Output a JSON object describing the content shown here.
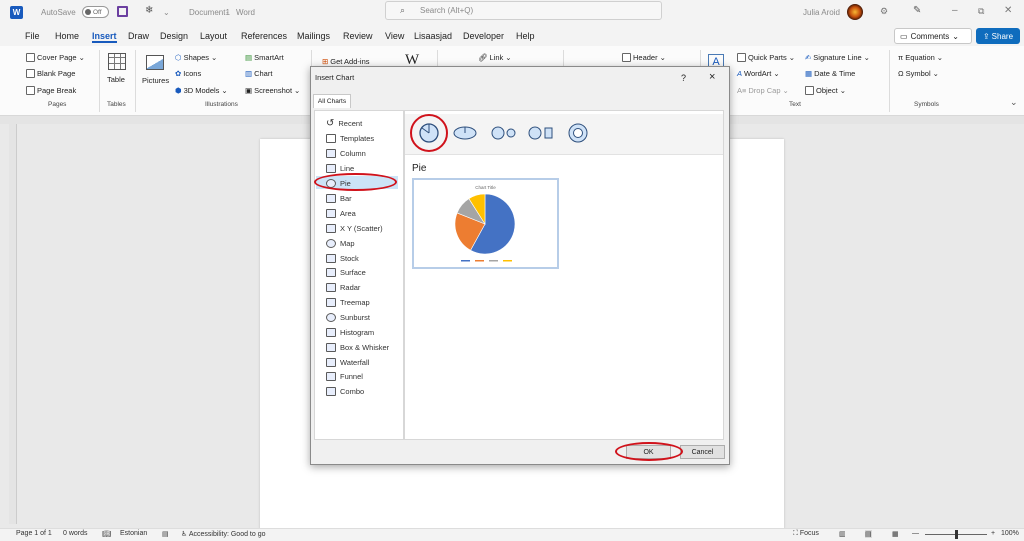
{
  "title_bar": {
    "autosave_label": "AutoSave",
    "autosave_state": "Off",
    "document_name": "Document1",
    "app_name": "Word",
    "search_placeholder": "Search (Alt+Q)",
    "user_name": "Julia Aroid"
  },
  "menu_tabs": [
    "File",
    "Home",
    "Insert",
    "Draw",
    "Design",
    "Layout",
    "References",
    "Mailings",
    "Review",
    "View",
    "Lisaasjad",
    "Developer",
    "Help"
  ],
  "active_tab": "Insert",
  "comments_label": "Comments",
  "share_label": "Share",
  "ribbon": {
    "pages": {
      "items": [
        "Cover Page",
        "Blank Page",
        "Page Break"
      ],
      "group": "Pages"
    },
    "tables": {
      "item": "Table",
      "group": "Tables"
    },
    "illustrations": {
      "pictures": "Pictures",
      "shapes": "Shapes",
      "icons": "Icons",
      "models3d": "3D Models",
      "smartart": "SmartArt",
      "chart": "Chart",
      "screenshot": "Screenshot",
      "group": "Illustrations"
    },
    "addins": {
      "get_addins": "Get Add-ins"
    },
    "links": {
      "link": "Link"
    },
    "header": {
      "header": "Header"
    },
    "text": {
      "quick_parts": "Quick Parts",
      "wordart": "WordArt",
      "drop_cap": "Drop Cap",
      "signature_line": "Signature Line",
      "date_time": "Date & Time",
      "object": "Object",
      "group": "Text"
    },
    "symbols": {
      "equation": "Equation",
      "symbol": "Symbol",
      "group": "Symbols"
    }
  },
  "dialog": {
    "title": "Insert Chart",
    "help": "?",
    "close": "×",
    "tab": "All Charts",
    "chart_types": [
      "Recent",
      "Templates",
      "Column",
      "Line",
      "Pie",
      "Bar",
      "Area",
      "X Y (Scatter)",
      "Map",
      "Stock",
      "Surface",
      "Radar",
      "Treemap",
      "Sunburst",
      "Histogram",
      "Box & Whisker",
      "Waterfall",
      "Funnel",
      "Combo"
    ],
    "selected_type": "Pie",
    "preview_heading": "Pie",
    "preview_chart_title": "Chart Title",
    "ok": "OK",
    "cancel": "Cancel"
  },
  "preview_chart": {
    "type": "pie",
    "values": [
      58,
      23,
      10,
      9
    ],
    "colors": [
      "#4472c4",
      "#ed7d31",
      "#a5a5a5",
      "#ffc000"
    ]
  },
  "status_bar": {
    "page": "Page 1 of 1",
    "words": "0 words",
    "language": "Estonian",
    "accessibility": "Accessibility: Good to go",
    "focus": "Focus",
    "zoom": "100%"
  },
  "colors": {
    "word_blue": "#185abd",
    "annotation_red": "#d0121b",
    "selection_blue": "#cce4f7",
    "share_blue": "#0f6cbd"
  }
}
